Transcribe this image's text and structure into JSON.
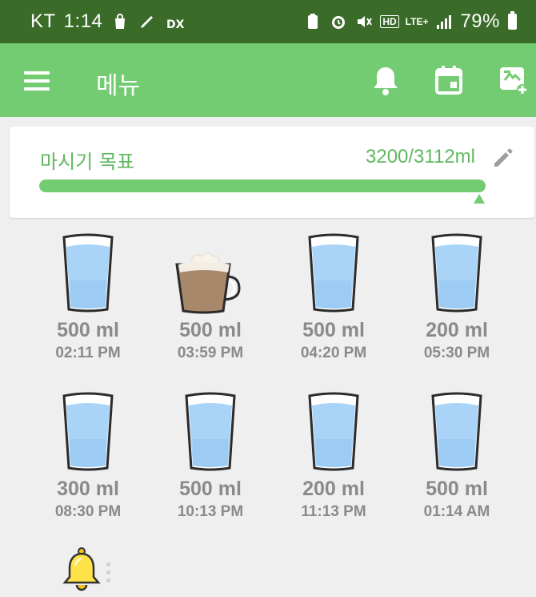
{
  "status_bar": {
    "carrier": "KT",
    "time": "1:14",
    "battery": "79%",
    "hd": "HD",
    "lte": "LTE+"
  },
  "app_bar": {
    "title": "메뉴",
    "icons": [
      "menu-icon",
      "bell-icon",
      "calendar-icon",
      "add-widget-icon"
    ]
  },
  "goal": {
    "label": "마시기 목표",
    "value": "3200/3112ml",
    "progress_fraction": 1.0
  },
  "entries": [
    {
      "amount": "500 ml",
      "time": "02:11 PM",
      "kind": "water"
    },
    {
      "amount": "500 ml",
      "time": "03:59 PM",
      "kind": "coffee"
    },
    {
      "amount": "500 ml",
      "time": "04:20 PM",
      "kind": "water"
    },
    {
      "amount": "200 ml",
      "time": "05:30 PM",
      "kind": "water"
    },
    {
      "amount": "300 ml",
      "time": "08:30 PM",
      "kind": "water"
    },
    {
      "amount": "500 ml",
      "time": "10:13 PM",
      "kind": "water"
    },
    {
      "amount": "200 ml",
      "time": "11:13 PM",
      "kind": "water"
    },
    {
      "amount": "500 ml",
      "time": "01:14 AM",
      "kind": "water"
    }
  ],
  "colors": {
    "status_bar": "#3a6b28",
    "app_bar": "#73cb72",
    "accent_text": "#5fb85e",
    "entry_text": "#8a8a8a"
  }
}
